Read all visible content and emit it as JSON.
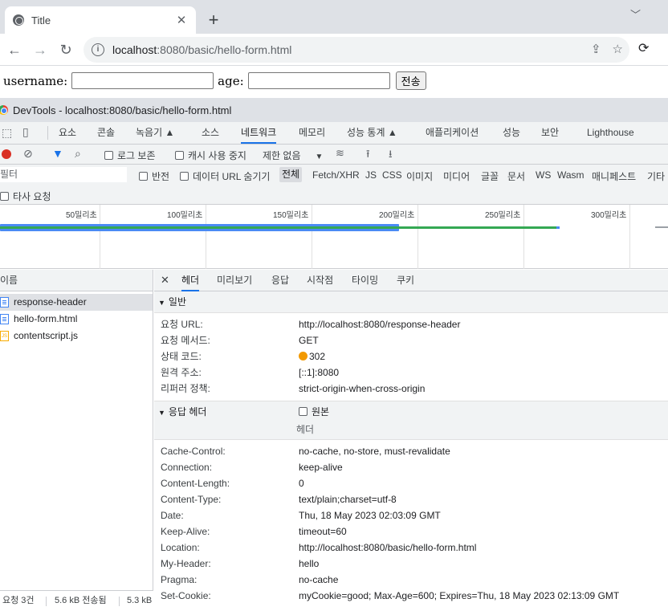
{
  "browser": {
    "tab_title": "Title",
    "url_host": "localhost",
    "url_rest": ":8080/basic/hello-form.html"
  },
  "page": {
    "username_label": "username:",
    "username_value": "",
    "age_label": "age:",
    "age_value": "",
    "submit_label": "전송"
  },
  "devtools": {
    "title": "DevTools - localhost:8080/basic/hello-form.html",
    "tabs": [
      "요소",
      "콘솔",
      "녹음기 ▲",
      "소스",
      "네트워크",
      "메모리",
      "성능 통계 ▲",
      "애플리케이션",
      "성능",
      "보안",
      "Lighthouse"
    ],
    "active_tab": "네트워크",
    "toolbar": {
      "preserve_log": "로그 보존",
      "disable_cache": "캐시 사용 중지",
      "throttle": "제한 없음"
    },
    "filter": {
      "placeholder": "필터",
      "invert": "반전",
      "hide_data_urls": "데이터 URL 숨기기",
      "types": [
        "전체",
        "Fetch/XHR",
        "JS",
        "CSS",
        "이미지",
        "미디어",
        "글꼴",
        "문서",
        "WS",
        "Wasm",
        "매니페스트",
        "기타"
      ],
      "third_party": "타사 요청"
    },
    "timeline_ticks": [
      "50밀리초",
      "100밀리초",
      "150밀리초",
      "200밀리초",
      "250밀리초",
      "300밀리초"
    ],
    "requests": {
      "header": "이름",
      "items": [
        {
          "name": "response-header",
          "type": "doc"
        },
        {
          "name": "hello-form.html",
          "type": "doc"
        },
        {
          "name": "contentscript.js",
          "type": "js"
        }
      ],
      "status": {
        "count": "요청 3건",
        "transferred": "5.6 kB 전송됨",
        "resources": "5.3 kB"
      }
    },
    "detail": {
      "tabs": [
        "헤더",
        "미리보기",
        "응답",
        "시작점",
        "타이밍",
        "쿠키"
      ],
      "general_title": "일반",
      "general": [
        {
          "k": "요청 URL:",
          "v": "http://localhost:8080/response-header"
        },
        {
          "k": "요청 메서드:",
          "v": "GET"
        },
        {
          "k": "상태 코드:",
          "v": "302"
        },
        {
          "k": "원격 주소:",
          "v": "[::1]:8080"
        },
        {
          "k": "리퍼러 정책:",
          "v": "strict-origin-when-cross-origin"
        }
      ],
      "response_title": "응답 헤더",
      "raw_label": "원본",
      "header_col": "헤더",
      "response_headers": [
        {
          "k": "Cache-Control:",
          "v": "no-cache, no-store, must-revalidate"
        },
        {
          "k": "Connection:",
          "v": "keep-alive"
        },
        {
          "k": "Content-Length:",
          "v": "0"
        },
        {
          "k": "Content-Type:",
          "v": "text/plain;charset=utf-8"
        },
        {
          "k": "Date:",
          "v": "Thu, 18 May 2023 02:03:09 GMT"
        },
        {
          "k": "Keep-Alive:",
          "v": "timeout=60"
        },
        {
          "k": "Location:",
          "v": "http://localhost:8080/basic/hello-form.html"
        },
        {
          "k": "My-Header:",
          "v": "hello"
        },
        {
          "k": "Pragma:",
          "v": "no-cache"
        },
        {
          "k": "Set-Cookie:",
          "v": "myCookie=good; Max-Age=600; Expires=Thu, 18 May 2023 02:13:09 GMT"
        }
      ]
    }
  }
}
